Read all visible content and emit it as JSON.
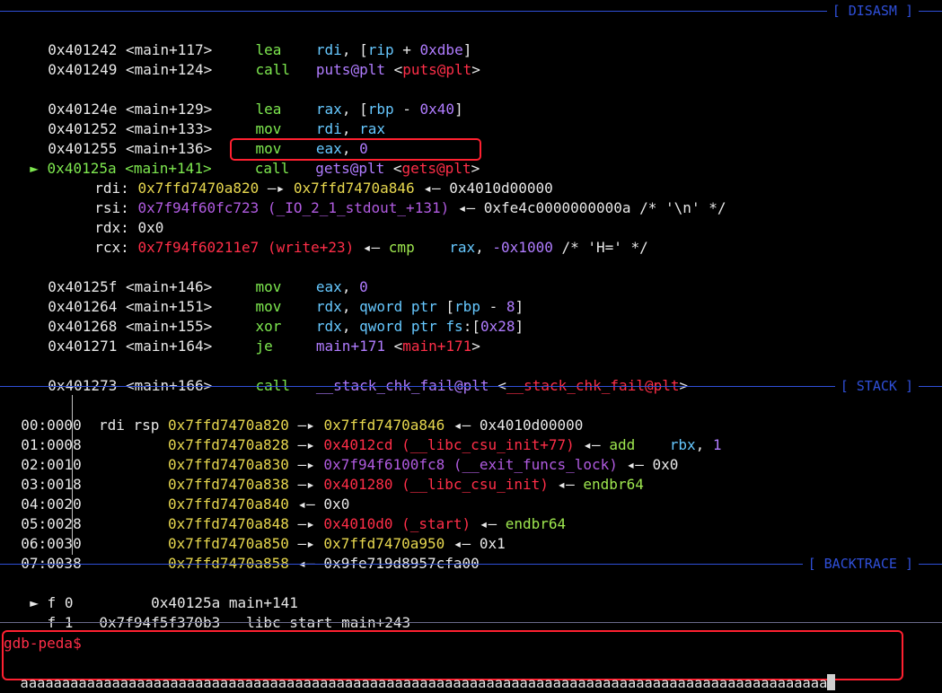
{
  "sections": {
    "disasm": "[ DISASM ]",
    "stack": "[ STACK ]",
    "backtrace": "[ BACKTRACE ]"
  },
  "disasm": [
    {
      "addr": "0x401242",
      "sym": "<main+117>",
      "op": "lea",
      "args": [
        "rdi, [",
        "rip",
        " + ",
        "0xdbe",
        "]"
      ]
    },
    {
      "addr": "0x401249",
      "sym": "<main+124>",
      "op": "call",
      "args": [
        "puts@plt",
        " <",
        "puts@plt",
        ">"
      ]
    },
    {
      "addr": "0x40124e",
      "sym": "<main+129>",
      "op": "lea",
      "args": [
        "rax, [",
        "rbp",
        " - ",
        "0x40",
        "]"
      ]
    },
    {
      "addr": "0x401252",
      "sym": "<main+133>",
      "op": "mov",
      "args": [
        "rdi",
        ", ",
        "rax"
      ]
    },
    {
      "addr": "0x401255",
      "sym": "<main+136>",
      "op": "mov",
      "args": [
        "eax",
        ", ",
        "0"
      ]
    },
    {
      "addr": "0x40125a",
      "sym": "<main+141>",
      "op": "call",
      "args": [
        "gets@plt",
        " <",
        "gets@plt",
        ">"
      ],
      "current": true
    },
    {
      "addr": "0x40125f",
      "sym": "<main+146>",
      "op": "mov",
      "args": [
        "eax",
        ", ",
        "0"
      ]
    },
    {
      "addr": "0x401264",
      "sym": "<main+151>",
      "op": "mov",
      "args": [
        "rdx",
        ", ",
        "qword ptr",
        " [",
        "rbp",
        " - ",
        "8",
        "]"
      ]
    },
    {
      "addr": "0x401268",
      "sym": "<main+155>",
      "op": "xor",
      "args": [
        "rdx",
        ", ",
        "qword ptr",
        " ",
        "fs",
        ":[",
        "0x28",
        "]"
      ]
    },
    {
      "addr": "0x401271",
      "sym": "<main+164>",
      "op": "je",
      "args": [
        "main+171",
        " <",
        "main+171",
        ">"
      ]
    },
    {
      "addr": "0x401273",
      "sym": "<main+166>",
      "op": "call",
      "args": [
        "__stack_chk_fail@plt",
        " <",
        "__stack_chk_fail@plt",
        ">"
      ]
    }
  ],
  "current_marker": "►",
  "args": {
    "rdi": {
      "name": "rdi:",
      "v1": "0x7ffd7470a820",
      "arrow": " —▸ ",
      "v2": "0x7ffd7470a846",
      "arrow2": " ◂— ",
      "v3": "0x4010d00000"
    },
    "rsi": {
      "name": "rsi:",
      "v1": "0x7f94f60fc723 (_IO_2_1_stdout_+131)",
      "arrow": " ◂— ",
      "v2": "0xfe4c0000000000a /* '\\n' */"
    },
    "rdx": {
      "name": "rdx:",
      "v1": "0x0"
    },
    "rcx": {
      "name": "rcx:",
      "v1": "0x7f94f60211e7 (write+23)",
      "arrow": " ◂— ",
      "op": "cmp",
      "reg": "rax",
      "sep": ", ",
      "neg": "-0x1000",
      "cmt": " /* 'H=' */"
    }
  },
  "stack": [
    {
      "off": "00:0000",
      "regs": "rdi rsp",
      "addr": "0x7ffd7470a820",
      "a1": " —▸ ",
      "v1": "0x7ffd7470a846",
      "a2": " ◂— ",
      "v2": "0x4010d00000",
      "kind": "stack"
    },
    {
      "off": "01:0008",
      "regs": "",
      "addr": "0x7ffd7470a828",
      "a1": " —▸ ",
      "v1": "0x4012cd (__libc_csu_init+77)",
      "a2": " ◂— ",
      "op": "add",
      "reg": "rbx",
      "sep": ", ",
      "num": "1",
      "kind": "code"
    },
    {
      "off": "02:0010",
      "regs": "",
      "addr": "0x7ffd7470a830",
      "a1": " —▸ ",
      "v1": "0x7f94f6100fc8 (__exit_funcs_lock)",
      "a2": " ◂— ",
      "v2": "0x0",
      "kind": "data"
    },
    {
      "off": "03:0018",
      "regs": "",
      "addr": "0x7ffd7470a838",
      "a1": " —▸ ",
      "v1": "0x401280 (__libc_csu_init)",
      "a2": " ◂— ",
      "op": "endbr64",
      "kind": "code"
    },
    {
      "off": "04:0020",
      "regs": "",
      "addr": "0x7ffd7470a840",
      "a1": " ◂— ",
      "v1": "0x0",
      "kind": "plain"
    },
    {
      "off": "05:0028",
      "regs": "",
      "addr": "0x7ffd7470a848",
      "a1": " —▸ ",
      "v1": "0x4010d0 (_start)",
      "a2": " ◂— ",
      "op": "endbr64",
      "kind": "code"
    },
    {
      "off": "06:0030",
      "regs": "",
      "addr": "0x7ffd7470a850",
      "a1": " —▸ ",
      "v1": "0x7ffd7470a950",
      "a2": " ◂— ",
      "v2": "0x1",
      "kind": "stack"
    },
    {
      "off": "07:0038",
      "regs": "",
      "addr": "0x7ffd7470a858",
      "a1": " ◂— ",
      "v1": "0x9fe719d8957cfa00",
      "kind": "plain"
    }
  ],
  "backtrace": [
    {
      "marker": "►",
      "frame": "f 0",
      "addr": "0x40125a",
      "sym": "main+141"
    },
    {
      "marker": "",
      "frame": "f 1",
      "addr": "0x7f94f5f370b3",
      "sym": "__libc_start_main+243"
    }
  ],
  "prompt": "gdb-peda$",
  "input": "aaaaaaaaaaaaaaaaaaaaaaaaaaaaaaaaaaaaaaaaaaaaaaaaaaaaaaaaaaaaaaaaaaaaaaaaaaaaaaaaaaaaaaaaaaaaaaaaa",
  "colors": {
    "rule": "#2f4fd8",
    "highlight": "#ff2030"
  }
}
